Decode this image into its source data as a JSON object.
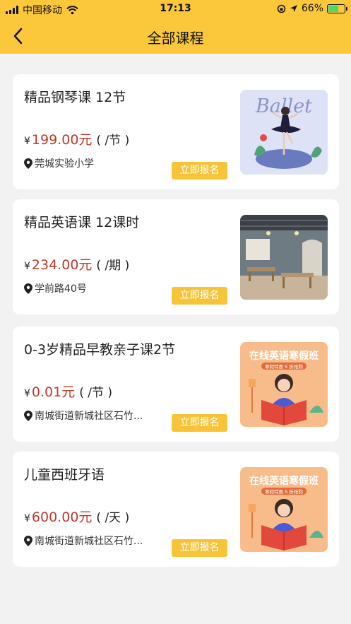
{
  "status_bar": {
    "carrier": "中国移动",
    "time": "17:13",
    "battery": "66%",
    "battery_level": 0.66
  },
  "header": {
    "title": "全部课程"
  },
  "currency_symbol": "¥",
  "courses": [
    {
      "title": "精品钢琴课 12节",
      "price": "199.00元",
      "unit": "( /节 )",
      "location": "莞城实验小学",
      "button": "立即报名",
      "image_text": "Ballet"
    },
    {
      "title": "精品英语课 12课时",
      "price": "234.00元",
      "unit": "( /期 )",
      "location": "学前路40号",
      "button": "立即报名"
    },
    {
      "title": "0-3岁精品早教亲子课2节",
      "price": "0.01元",
      "unit": "( /节 )",
      "location": "南城街道新城社区石竹...",
      "button": "立即报名",
      "image_text": "在线英语寒假班",
      "image_subtext": "寒假特惠 5 折抢购"
    },
    {
      "title": "儿童西班牙语",
      "price": "600.00元",
      "unit": "( /天 )",
      "location": "南城街道新城社区石竹...",
      "button": "立即报名",
      "image_text": "在线英语寒假班",
      "image_subtext": "寒假特惠 5 折抢购"
    }
  ]
}
